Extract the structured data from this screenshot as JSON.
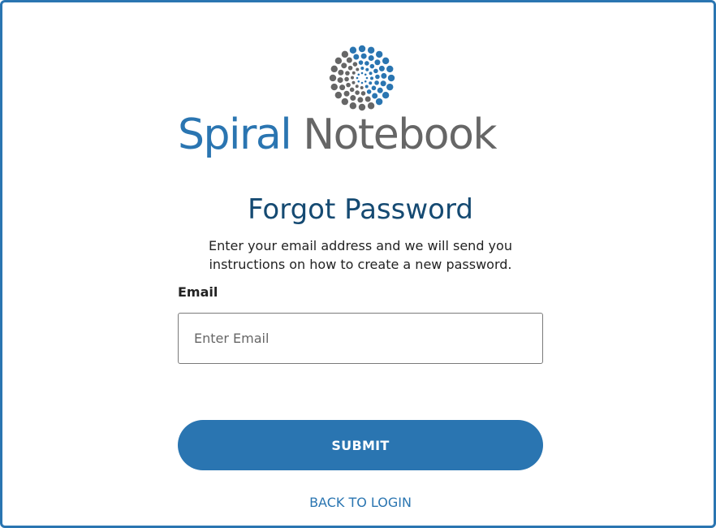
{
  "brand": {
    "logo_icon": "dotted-spiral-icon",
    "word_primary": "Spiral",
    "word_secondary": "Notebook",
    "colors": {
      "primary": "#2a75b1",
      "gray": "#666666",
      "title": "#154a72"
    }
  },
  "form": {
    "title": "Forgot Password",
    "description_line1": "Enter your email address and we will send you",
    "description_line2": "instructions on how to create a new password.",
    "email_label": "Email",
    "email_placeholder": "Enter Email",
    "email_value": "",
    "submit_label": "SUBMIT",
    "back_link_label": "BACK TO LOGIN"
  }
}
